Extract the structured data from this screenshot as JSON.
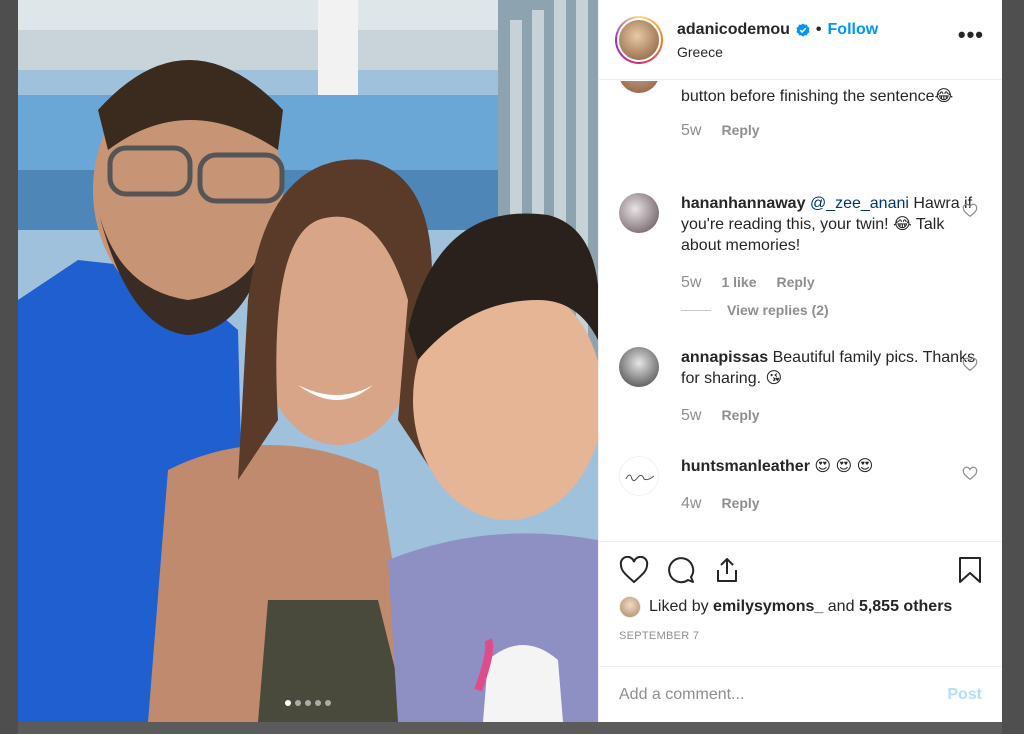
{
  "colors": {
    "accent": "#0095f6",
    "secondary_text": "#8e8e8e",
    "primary_text": "#262626",
    "post_disabled": "#b2dffc"
  },
  "header": {
    "username": "adanicodemou",
    "separator": "•",
    "follow_label": "Follow",
    "location": "Greece",
    "more_label": "•••",
    "verified_icon": "verified-badge-icon"
  },
  "carousel": {
    "count": 5,
    "active_index": 0
  },
  "comments": [
    {
      "user": "",
      "text": "button before finishing the sentence😂",
      "time": "5w",
      "reply_label": "Reply"
    },
    {
      "user": "hananhannaway",
      "mention": "@_zee_anani",
      "text": " Hawra if you're reading this, your twin! 😂  Talk about memories!",
      "time": "5w",
      "likes": "1 like",
      "reply_label": "Reply",
      "view_replies": "View replies (2)"
    },
    {
      "user": "annapissas",
      "text": " Beautiful family pics. Thanks for sharing. 😘",
      "time": "5w",
      "reply_label": "Reply"
    },
    {
      "user": "huntsmanleather",
      "text": " 😍 😍 😍",
      "time": "4w",
      "reply_label": "Reply"
    }
  ],
  "actions": {
    "liked_by_prefix": "Liked by",
    "liked_by_user": "emilysymons_",
    "liked_by_and": "and",
    "liked_by_others": "5,855 others",
    "date": "SEPTEMBER 7"
  },
  "add_comment": {
    "placeholder": "Add a comment...",
    "post_label": "Post"
  }
}
